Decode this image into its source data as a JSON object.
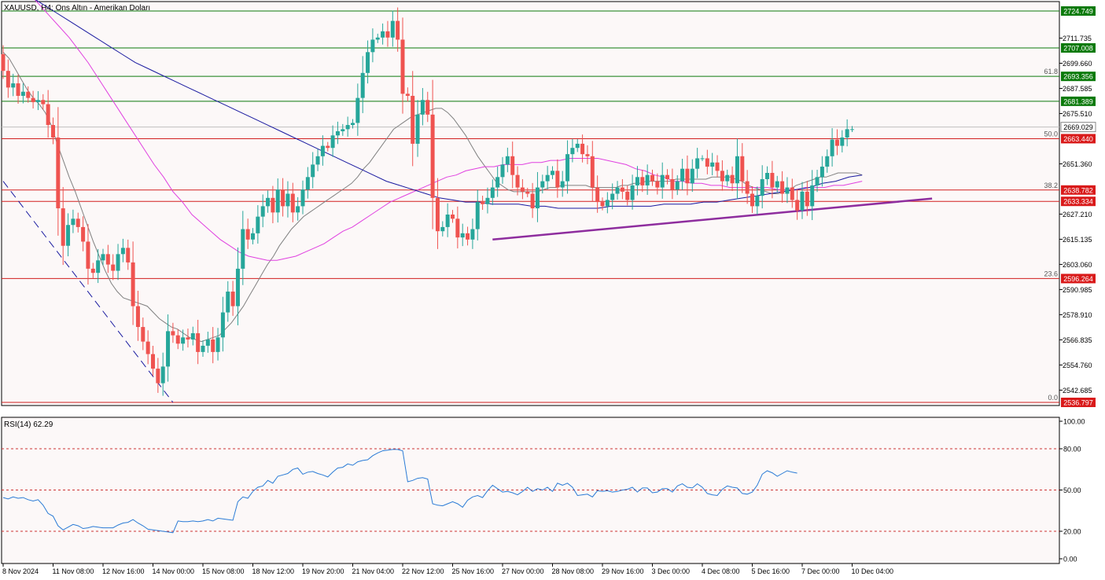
{
  "header": {
    "symbol_label": "XAUUSD, H4:  Ons Altın - Amerikan Doları",
    "rsi_label": "RSI(14) 62.29"
  },
  "colors": {
    "background": "#fcf8f8",
    "bull": "#26a69a",
    "bear": "#ef5350",
    "ma_fast": "#808080",
    "ma_mid": "#e040e0",
    "ma_slow": "#1a1aa0",
    "trendline": "#8e2d9e",
    "resistance_line": "#0d7a0d",
    "support_line": "#d11f1f",
    "rsi_line": "#2a7bd6",
    "rsi_level": "#cc3333"
  },
  "chart_data": [
    {
      "type": "candlestick",
      "symbol": "XAUUSD",
      "timeframe": "H4",
      "ylim": [
        2536.797,
        2726.0
      ],
      "price_ticks": [
        "2711.735",
        "2699.660",
        "2687.585",
        "2675.510",
        "2651.360",
        "2627.210",
        "2615.135",
        "2603.060",
        "2590.985",
        "2578.910",
        "2566.835",
        "2554.760",
        "2542.685"
      ],
      "levels": [
        {
          "value": 2724.749,
          "label": "2724.749",
          "kind": "resistance",
          "fib": ""
        },
        {
          "value": 2707.008,
          "label": "2707.008",
          "kind": "resistance",
          "fib": ""
        },
        {
          "value": 2693.356,
          "label": "2693.356",
          "kind": "resistance",
          "fib": "61.8"
        },
        {
          "value": 2681.389,
          "label": "2681.389",
          "kind": "resistance",
          "fib": ""
        },
        {
          "value": 2669.029,
          "label": "2669.029",
          "kind": "current",
          "fib": ""
        },
        {
          "value": 2663.44,
          "label": "2663.440",
          "kind": "support",
          "fib": "50.0"
        },
        {
          "value": 2638.782,
          "label": "2638.782",
          "kind": "support",
          "fib": "38.2"
        },
        {
          "value": 2633.334,
          "label": "2633.334",
          "kind": "support",
          "fib": ""
        },
        {
          "value": 2596.264,
          "label": "2596.264",
          "kind": "support",
          "fib": "23.6"
        },
        {
          "value": 2536.797,
          "label": "2536.797",
          "kind": "support",
          "fib": "0.0"
        }
      ],
      "x_labels": [
        {
          "index": 0,
          "label": "8 Nov 2024"
        },
        {
          "index": 10,
          "label": "11 Nov 08:00"
        },
        {
          "index": 20,
          "label": "12 Nov 16:00"
        },
        {
          "index": 30,
          "label": "14 Nov 00:00"
        },
        {
          "index": 40,
          "label": "15 Nov 08:00"
        },
        {
          "index": 50,
          "label": "18 Nov 12:00"
        },
        {
          "index": 60,
          "label": "19 Nov 20:00"
        },
        {
          "index": 70,
          "label": "21 Nov 04:00"
        },
        {
          "index": 80,
          "label": "22 Nov 12:00"
        },
        {
          "index": 90,
          "label": "25 Nov 16:00"
        },
        {
          "index": 100,
          "label": "27 Nov 00:00"
        },
        {
          "index": 110,
          "label": "28 Nov 08:00"
        },
        {
          "index": 120,
          "label": "29 Nov 16:00"
        },
        {
          "index": 130,
          "label": "3 Dec 00:00"
        },
        {
          "index": 140,
          "label": "4 Dec 08:00"
        },
        {
          "index": 150,
          "label": "5 Dec 16:00"
        },
        {
          "index": 160,
          "label": "7 Dec 00:00"
        },
        {
          "index": 170,
          "label": "10 Dec 04:00"
        }
      ],
      "closes": [
        2696,
        2688,
        2690,
        2684,
        2686,
        2683,
        2681,
        2682,
        2680,
        2670,
        2664,
        2630,
        2612,
        2622,
        2625,
        2621,
        2614,
        2601,
        2599,
        2605,
        2608,
        2603,
        2600,
        2608,
        2611,
        2604,
        2583,
        2573,
        2566,
        2560,
        2553,
        2546,
        2554,
        2571,
        2569,
        2565,
        2568,
        2567,
        2570,
        2561,
        2564,
        2567,
        2561,
        2568,
        2580,
        2590,
        2583,
        2601,
        2620,
        2615,
        2618,
        2626,
        2631,
        2635,
        2628,
        2639,
        2631,
        2637,
        2628,
        2631,
        2639,
        2645,
        2651,
        2655,
        2660,
        2659,
        2665,
        2667,
        2668,
        2670,
        2671,
        2683,
        2695,
        2705,
        2711,
        2712,
        2715,
        2712,
        2720,
        2711,
        2685,
        2684,
        2661,
        2675,
        2682,
        2675,
        2635,
        2619,
        2621,
        2627,
        2625,
        2616,
        2618,
        2615,
        2620,
        2633,
        2632,
        2635,
        2640,
        2645,
        2651,
        2655,
        2646,
        2640,
        2638,
        2637,
        2630,
        2640,
        2643,
        2646,
        2648,
        2640,
        2643,
        2656,
        2659,
        2661,
        2656,
        2655,
        2640,
        2633,
        2631,
        2634,
        2637,
        2640,
        2638,
        2634,
        2641,
        2645,
        2641,
        2646,
        2643,
        2640,
        2646,
        2644,
        2639,
        2643,
        2649,
        2642,
        2649,
        2654,
        2654,
        2650,
        2652,
        2648,
        2643,
        2646,
        2642,
        2655,
        2643,
        2637,
        2631,
        2636,
        2644,
        2647,
        2640,
        2643,
        2637,
        2640,
        2634,
        2629,
        2638,
        2631,
        2641,
        2645,
        2650,
        2655,
        2663,
        2660,
        2664,
        2668,
        2668
      ],
      "fast_ma": [
        2705,
        2702,
        2697,
        2692,
        2687,
        2683,
        2680,
        2676,
        2670,
        2661,
        2653,
        2645,
        2638,
        2630,
        2622,
        2614,
        2607,
        2600,
        2594,
        2590,
        2587,
        2586,
        2585,
        2584,
        2583,
        2580,
        2577,
        2575,
        2573,
        2572,
        2570,
        2568,
        2567,
        2566,
        2567,
        2568,
        2569,
        2572,
        2575,
        2579,
        2583,
        2588,
        2593,
        2598,
        2603,
        2607,
        2612,
        2616,
        2620,
        2623,
        2626,
        2628,
        2630,
        2632,
        2634,
        2636,
        2638,
        2640,
        2642,
        2645,
        2649,
        2652,
        2656,
        2660,
        2664,
        2668,
        2670,
        2672,
        2674,
        2675,
        2676,
        2677,
        2678,
        2678,
        2676,
        2673,
        2669,
        2665,
        2660,
        2655,
        2651,
        2647,
        2643,
        2641,
        2639,
        2638,
        2638,
        2638,
        2638,
        2638,
        2639,
        2640,
        2640,
        2641,
        2641,
        2641,
        2641,
        2641,
        2640,
        2640,
        2640,
        2640,
        2640,
        2641,
        2641,
        2642,
        2642,
        2643,
        2643,
        2643,
        2643,
        2643,
        2644,
        2644,
        2644,
        2644,
        2644,
        2644,
        2645,
        2645,
        2645,
        2645,
        2644,
        2643,
        2641,
        2640,
        2639,
        2638,
        2637,
        2637,
        2638,
        2639,
        2641,
        2642,
        2643,
        2644,
        2645,
        2645,
        2646,
        2647,
        2647,
        2647,
        2647,
        2646
      ],
      "mid_ma": [
        2745,
        2742,
        2737,
        2732,
        2727,
        2722,
        2717,
        2712,
        2706,
        2700,
        2693,
        2686,
        2679,
        2672,
        2665,
        2658,
        2651,
        2645,
        2638,
        2633,
        2627,
        2623,
        2619,
        2615,
        2612,
        2609,
        2607,
        2606,
        2605,
        2605,
        2606,
        2607,
        2609,
        2611,
        2613,
        2616,
        2619,
        2621,
        2624,
        2627,
        2630,
        2633,
        2635,
        2637,
        2639,
        2641,
        2643,
        2645,
        2646,
        2648,
        2649,
        2650,
        2650,
        2651,
        2651,
        2651,
        2652,
        2652,
        2653,
        2653,
        2654,
        2654,
        2654,
        2654,
        2653,
        2652,
        2651,
        2649,
        2648,
        2646,
        2645,
        2643,
        2643,
        2642,
        2642,
        2641,
        2641,
        2640,
        2640,
        2640,
        2640,
        2640,
        2639,
        2639,
        2639,
        2640,
        2640,
        2640,
        2641,
        2641,
        2642,
        2643
      ],
      "slow_ma": [
        2740,
        2736,
        2732,
        2728,
        2724,
        2720,
        2716,
        2712,
        2708,
        2704,
        2700,
        2697,
        2694,
        2691,
        2688,
        2685,
        2682,
        2679,
        2676,
        2673,
        2670,
        2667,
        2664,
        2661,
        2658,
        2655,
        2652,
        2649,
        2646,
        2643,
        2641,
        2639,
        2637,
        2635,
        2634,
        2633,
        2633,
        2632,
        2632,
        2632,
        2631,
        2631,
        2630,
        2630,
        2630,
        2630,
        2631,
        2631,
        2631,
        2631,
        2632,
        2632,
        2632,
        2633,
        2633,
        2634,
        2635,
        2636,
        2637,
        2638,
        2639,
        2640,
        2642,
        2643,
        2645,
        2646
      ],
      "trendline": {
        "from_index": 98,
        "from_price": 2615.0,
        "to_index": 186,
        "to_price": 2634.7
      },
      "descending_line": {
        "from_index": 0,
        "from_price": 2643.0,
        "to_index": 34,
        "to_price": 2536.8
      }
    },
    {
      "type": "line",
      "indicator": "RSI",
      "period": 14,
      "current": 62.29,
      "ylim": [
        0,
        100
      ],
      "ticks": [
        "100.00",
        "80.00",
        "50.00",
        "20.00",
        "0.00"
      ],
      "levels": [
        80,
        50,
        20
      ],
      "values": [
        44.5,
        43.5,
        45.0,
        44.0,
        44.5,
        43.0,
        42.0,
        43.0,
        39.0,
        33.0,
        31.0,
        24.0,
        21.0,
        23.0,
        25.0,
        24.0,
        22.0,
        22.5,
        23.5,
        23.0,
        22.5,
        22.5,
        22.5,
        24.5,
        26.0,
        26.5,
        28.5,
        26.0,
        24.0,
        21.5,
        21.0,
        20.5,
        20.0,
        19.5,
        19.0,
        27.5,
        27.0,
        27.0,
        27.5,
        27.0,
        27.5,
        28.5,
        27.5,
        29.5,
        29.0,
        28.5,
        28.0,
        41.5,
        45.0,
        44.0,
        49.0,
        52.0,
        53.0,
        57.0,
        55.0,
        60.0,
        61.0,
        62.0,
        65.0,
        66.0,
        61.5,
        63.0,
        63.5,
        62.0,
        61.0,
        59.5,
        63.0,
        66.0,
        66.5,
        69.0,
        68.0,
        70.5,
        71.5,
        72.0,
        75.0,
        77.0,
        78.5,
        79.0,
        79.5,
        79.5,
        78.5,
        56.0,
        57.0,
        58.5,
        59.0,
        58.0,
        40.0,
        39.0,
        38.5,
        40.0,
        41.5,
        40.0,
        37.5,
        42.5,
        45.0,
        46.0,
        44.5,
        49.5,
        53.5,
        51.0,
        48.5,
        49.0,
        48.0,
        46.5,
        49.0,
        52.0,
        49.0,
        51.0,
        50.0,
        52.0,
        49.0,
        55.0,
        53.5,
        55.0,
        52.0,
        46.0,
        46.5,
        47.0,
        45.0,
        49.5,
        49.0,
        49.5,
        48.5,
        49.0,
        50.0,
        50.5,
        52.0,
        48.5,
        51.5,
        51.5,
        48.0,
        48.5,
        51.0,
        51.0,
        48.5,
        53.0,
        54.5,
        52.0,
        51.5,
        54.5,
        52.0,
        47.5,
        46.5,
        46.0,
        50.5,
        53.0,
        52.0,
        51.5,
        47.5,
        47.0,
        48.5,
        53.5,
        61.5,
        64.0,
        62.5,
        60.0,
        62.0,
        64.0,
        63.0,
        62.29
      ]
    }
  ]
}
